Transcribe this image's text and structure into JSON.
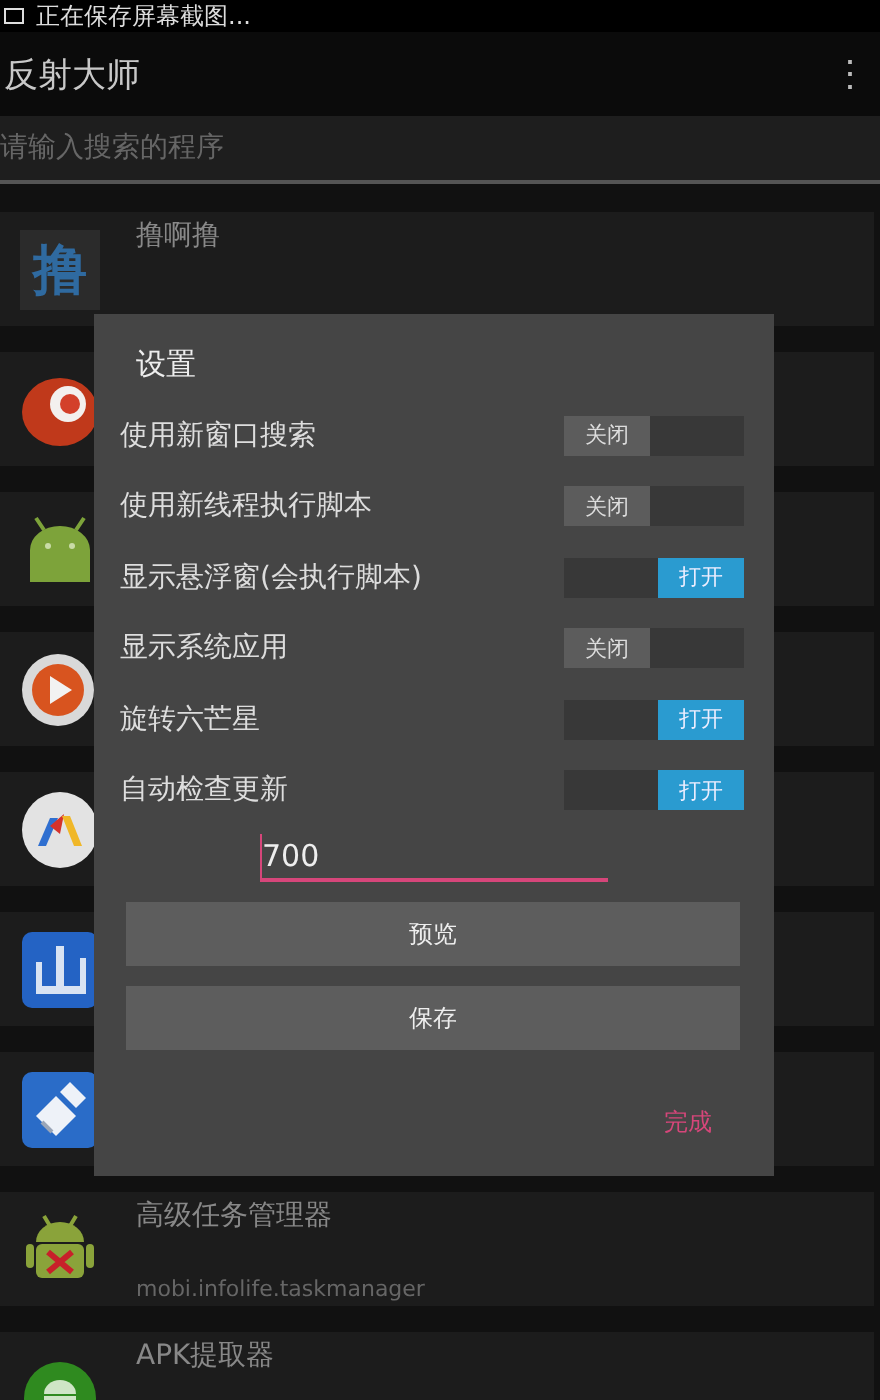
{
  "status_bar": {
    "notification": "正在保存屏幕截图..."
  },
  "app_bar": {
    "title": "反射大师",
    "menu": "⋮"
  },
  "search": {
    "placeholder": "请输入搜索的程序"
  },
  "apps": [
    {
      "kind": "text-icon",
      "icon_text": "撸",
      "name": "撸啊撸"
    },
    {
      "kind": "red-blob"
    },
    {
      "kind": "android"
    },
    {
      "kind": "play"
    },
    {
      "kind": "arch"
    },
    {
      "kind": "mountain"
    },
    {
      "kind": "brush"
    },
    {
      "kind": "android-x",
      "name": "高级任务管理器",
      "package": "mobi.infolife.taskmanager"
    },
    {
      "kind": "android-round",
      "name": "APK提取器"
    }
  ],
  "dialog": {
    "title": "设置",
    "settings": [
      {
        "label": "使用新窗口搜索",
        "on": false,
        "state_text": "关闭"
      },
      {
        "label": "使用新线程执行脚本",
        "on": false,
        "state_text": "关闭"
      },
      {
        "label": "显示悬浮窗(会执行脚本)",
        "on": true,
        "state_text": "打开"
      },
      {
        "label": "显示系统应用",
        "on": false,
        "state_text": "关闭"
      },
      {
        "label": "旋转六芒星",
        "on": true,
        "state_text": "打开"
      },
      {
        "label": "自动检查更新",
        "on": true,
        "state_text": "打开"
      }
    ],
    "input": {
      "value": "700"
    },
    "buttons": [
      "预览",
      "保存"
    ],
    "done": "完成"
  }
}
